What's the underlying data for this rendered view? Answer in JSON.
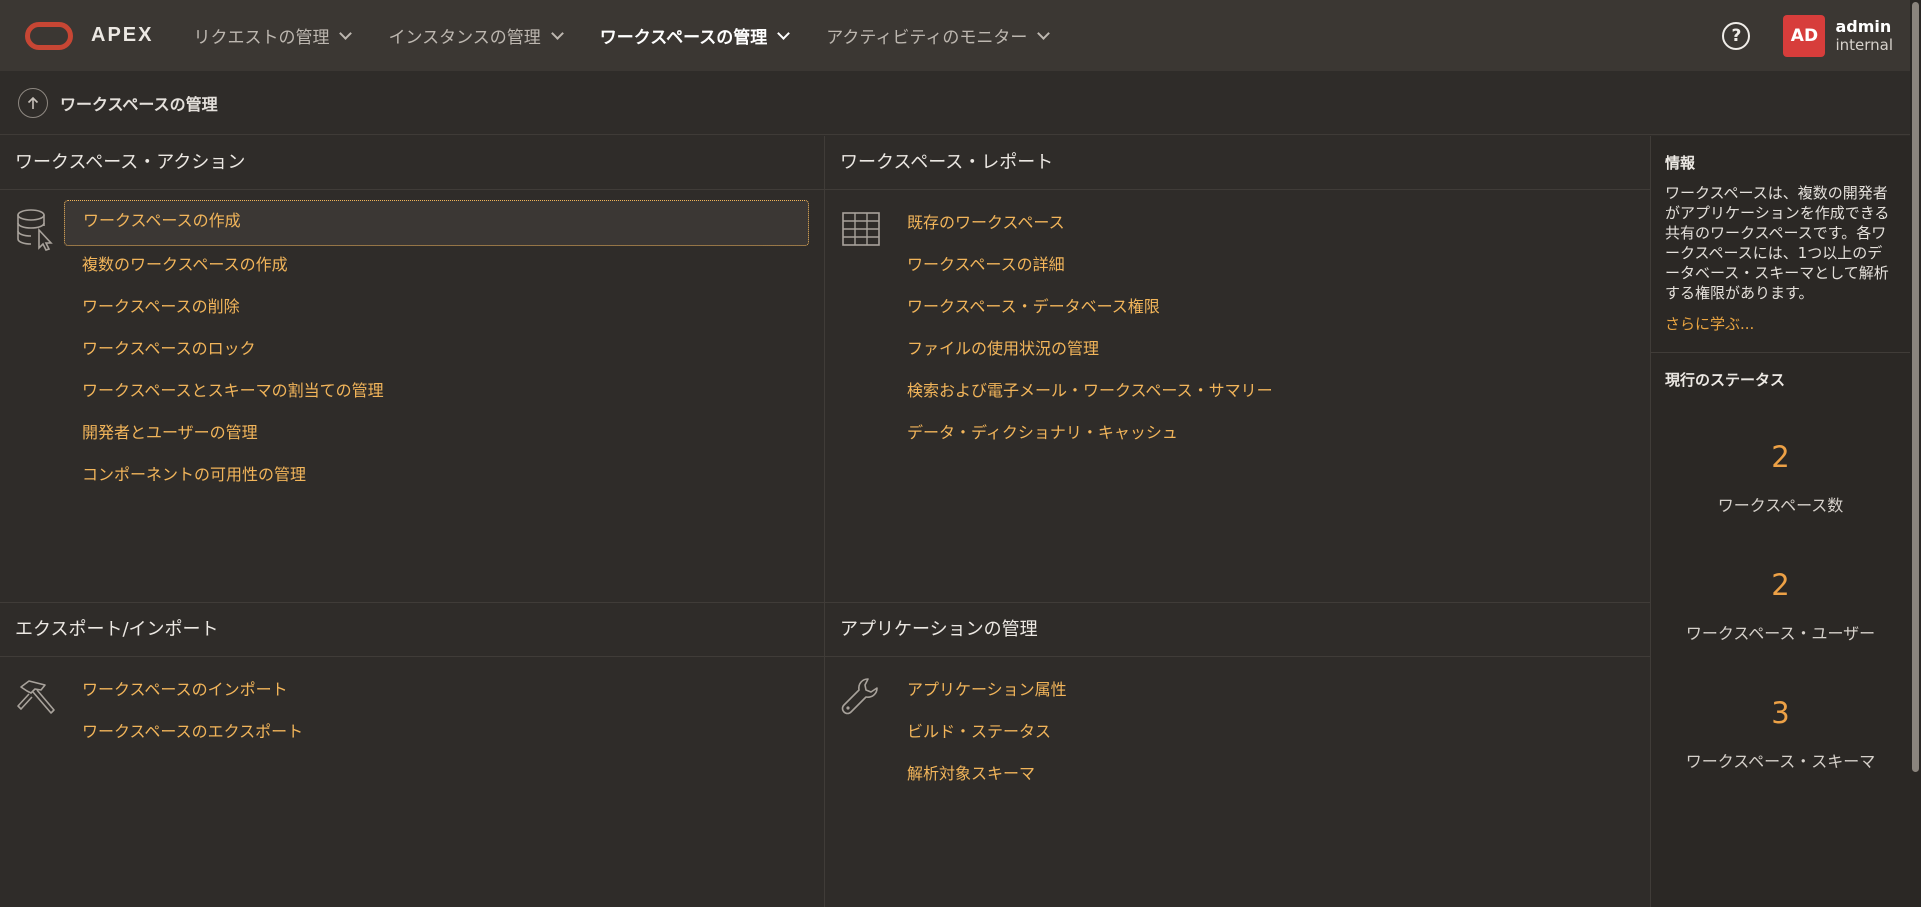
{
  "app": {
    "brand": "APEX"
  },
  "nav": {
    "items": [
      {
        "label": "リクエストの管理"
      },
      {
        "label": "インスタンスの管理"
      },
      {
        "label": "ワークスペースの管理"
      },
      {
        "label": "アクティビティのモニター"
      }
    ],
    "active_index": 2
  },
  "header": {
    "help_label": "?",
    "avatar_initials": "AD",
    "user_name": "admin",
    "user_role": "internal"
  },
  "breadcrumb": {
    "title": "ワークスペースの管理"
  },
  "panels": {
    "workspace_actions": {
      "title": "ワークスペース・アクション",
      "icon": "database-cursor-icon",
      "links": [
        "ワークスペースの作成",
        "複数のワークスペースの作成",
        "ワークスペースの削除",
        "ワークスペースのロック",
        "ワークスペースとスキーマの割当ての管理",
        "開発者とユーザーの管理",
        "コンポーネントの可用性の管理"
      ]
    },
    "workspace_reports": {
      "title": "ワークスペース・レポート",
      "icon": "table-grid-icon",
      "links": [
        "既存のワークスペース",
        "ワークスペースの詳細",
        "ワークスペース・データベース権限",
        "ファイルの使用状況の管理",
        "検索および電子メール・ワークスペース・サマリー",
        "データ・ディクショナリ・キャッシュ"
      ]
    },
    "export_import": {
      "title": "エクスポート/インポート",
      "icon": "hammer-icon",
      "links": [
        "ワークスペースのインポート",
        "ワークスペースのエクスポート"
      ]
    },
    "app_management": {
      "title": "アプリケーションの管理",
      "icon": "wrench-icon",
      "links": [
        "アプリケーション属性",
        "ビルド・ステータス",
        "解析対象スキーマ"
      ]
    }
  },
  "side": {
    "info_title": "情報",
    "info_text": "ワークスペースは、複数の開発者がアプリケーションを作成できる共有のワークスペースです。各ワークスペースには、1つ以上のデータベース・スキーマとして解析する権限があります。",
    "learn_more": "さらに学ぶ...",
    "status_title": "現行のステータス",
    "stats": [
      {
        "value": "2",
        "label": "ワークスペース数"
      },
      {
        "value": "2",
        "label": "ワークスペース・ユーザー"
      },
      {
        "value": "3",
        "label": "ワークスペース・スキーマ"
      }
    ]
  },
  "colors": {
    "accent_link": "#f2b55a",
    "stat_number": "#eda146",
    "brand_red": "#c74634",
    "avatar_bg": "#d73d3b"
  }
}
